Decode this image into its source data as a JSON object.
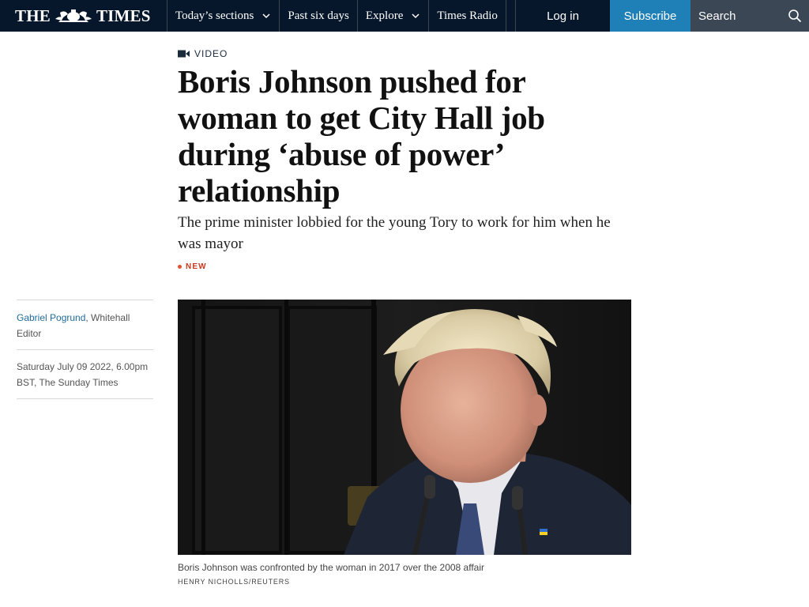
{
  "nav": {
    "logo_left": "THE",
    "logo_right": "TIMES",
    "items": [
      {
        "label": "Today’s sections",
        "has_dropdown": true
      },
      {
        "label": "Past six days",
        "has_dropdown": false
      },
      {
        "label": "Explore",
        "has_dropdown": true
      },
      {
        "label": "Times Radio",
        "has_dropdown": false
      }
    ],
    "login_label": "Log in",
    "subscribe_label": "Subscribe",
    "search_placeholder": "Search"
  },
  "article": {
    "kicker": "VIDEO",
    "headline": "Boris Johnson pushed for woman to get City Hall job during ‘abuse of power’ relationship",
    "standfirst": "The prime minister lobbied for the young Tory to work for him when he was mayor",
    "flag": "NEW",
    "author_name": "Gabriel Pogrund",
    "author_role": ", Whitehall Editor",
    "date": "Saturday July 09 2022, 6.00pm BST, The Sunday Times",
    "image_caption": "Boris Johnson was confronted by the woman in 2017 over the 2008 affair",
    "image_credit": "HENRY NICHOLLS/REUTERS"
  },
  "colors": {
    "nav_bg": "#07172b",
    "subscribe_bg": "#1f7fb7",
    "search_bg": "#3c4756",
    "new_flag": "#c8381e",
    "author_link": "#1f6b9a"
  },
  "icons": [
    "crest-icon",
    "chevron-down-icon",
    "search-icon",
    "video-camera-icon"
  ]
}
